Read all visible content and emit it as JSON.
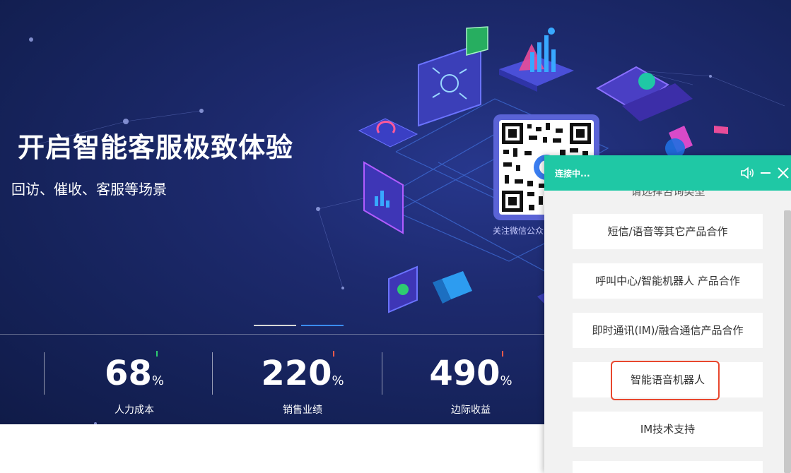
{
  "banner": {
    "title": "开启智能客服极致体验",
    "subtitle": "回访、催收、客服等场景",
    "qr_caption": "关注微信公众",
    "stats": [
      {
        "value": "68",
        "unit": "%",
        "label": "人力成本",
        "mark_color": "#2ecc71"
      },
      {
        "value": "220",
        "unit": "%",
        "label": "销售业绩",
        "mark_color": "#ff5a4a"
      },
      {
        "value": "490",
        "unit": "%",
        "label": "边际收益",
        "mark_color": "#ff5a4a"
      }
    ]
  },
  "chat": {
    "status": "连接中...",
    "cut_text": "请选择咨询类型",
    "options": [
      "短信/语音等其它产品合作",
      "呼叫中心/智能机器人 产品合作",
      "即时通讯(IM)/融合通信产品合作",
      "智能语音机器人",
      "IM技术支持"
    ],
    "header_color": "#1fc8a5",
    "highlight_color": "#e8472e"
  }
}
